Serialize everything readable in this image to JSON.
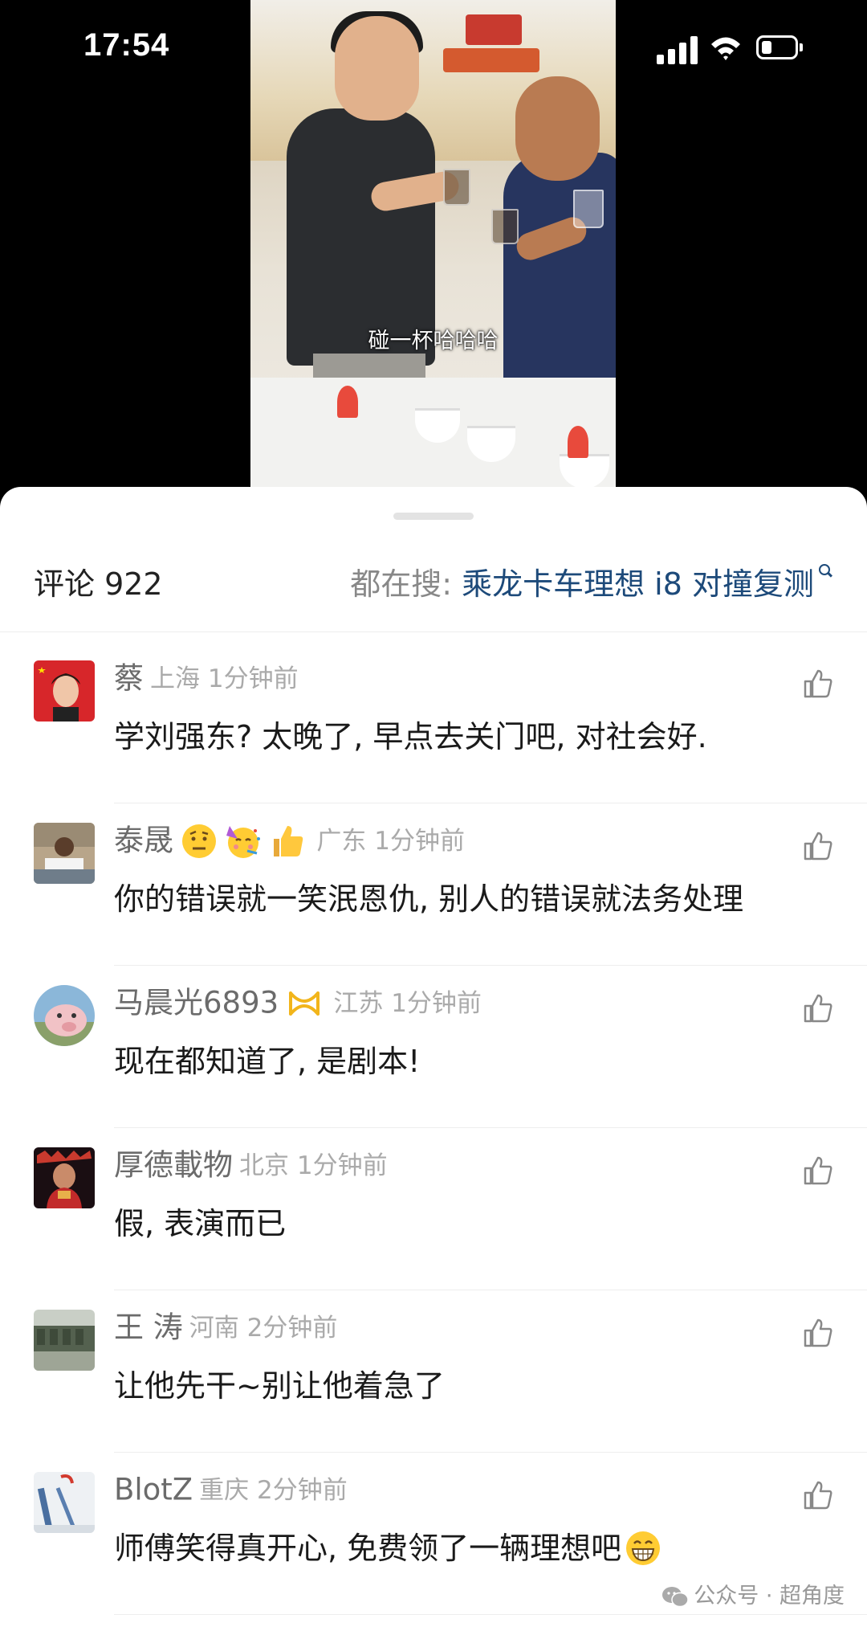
{
  "status_bar": {
    "time": "17:54"
  },
  "video": {
    "caption": "碰一杯哈哈哈"
  },
  "comments_header": {
    "title": "评论 922",
    "search_prefix": "都在搜: ",
    "search_topic": "乘龙卡车理想 i8 对撞复测"
  },
  "comments": [
    {
      "name": "蔡",
      "location": "上海 1分钟前",
      "text": "学刘强东? 太晚了, 早点去关门吧, 对社会好.",
      "avatar_color": "#d7262a"
    },
    {
      "name": "泰晟",
      "location": "广东 1分钟前",
      "text": "你的错误就一笑泯恩仇, 别人的错误就法务处理",
      "emojis": [
        "raised-eyebrow-emoji",
        "party-face-emoji",
        "thumbs-up-emoji"
      ]
    },
    {
      "name": "马晨光6893",
      "location": "江苏 1分钟前",
      "text": "现在都知道了, 是剧本!",
      "badge": "vip-badge-icon"
    },
    {
      "name": "厚德載物",
      "location": "北京 1分钟前",
      "text": "假, 表演而已"
    },
    {
      "name": "王 涛",
      "location": "河南 2分钟前",
      "text": "让他先干~别让他着急了"
    },
    {
      "name": "BlotZ",
      "location": "重庆 2分钟前",
      "text": "师傅笑得真开心, 免费领了一辆理想吧",
      "emojis": [
        "grinning-emoji"
      ]
    }
  ],
  "watermark": {
    "text": "公众号 · 超角度"
  }
}
